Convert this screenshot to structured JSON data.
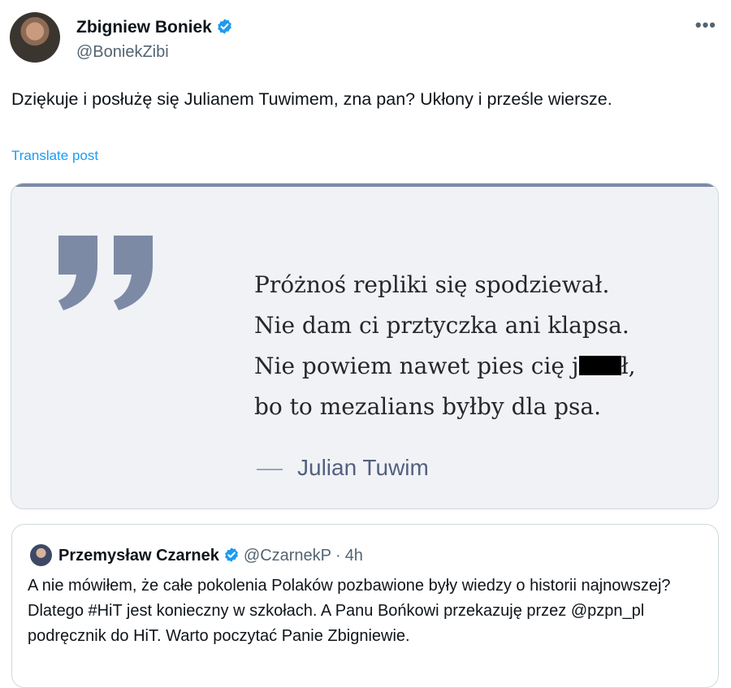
{
  "author": {
    "name": "Zbigniew Boniek",
    "handle": "@BoniekZibi"
  },
  "post": {
    "text": "Dziękuje i posłużę się Julianem Tuwimem,  zna pan? Ukłony i prześle wiersze.",
    "translate_label": "Translate post",
    "more_label": "•••"
  },
  "media": {
    "quote_lines": [
      "Próżnoś repliki się spodziewał.",
      "Nie dam ci prztyczka ani klapsa.",
      "Nie powiem nawet pies cię j",
      "ł,",
      "bo to mezalians byłby dla psa."
    ],
    "attribution": "Julian Tuwim"
  },
  "quoted_post": {
    "name": "Przemysław Czarnek",
    "handle": "@CzarnekP",
    "separator": "·",
    "time": "4h",
    "text": "A nie mówiłem, że całe pokolenia Polaków pozbawione były wiedzy o historii najnowszej? Dlatego #HiT jest konieczny w szkołach. A Panu Bońkowi przekazuję przez @pzpn_pl podręcznik do HiT. Warto poczytać Panie Zbigniewie."
  },
  "colors": {
    "link": "#1d9bf0",
    "verified": "#1d9bf0",
    "quote_mark": "#7d8aa6",
    "card_bg": "#f0f2f6"
  }
}
